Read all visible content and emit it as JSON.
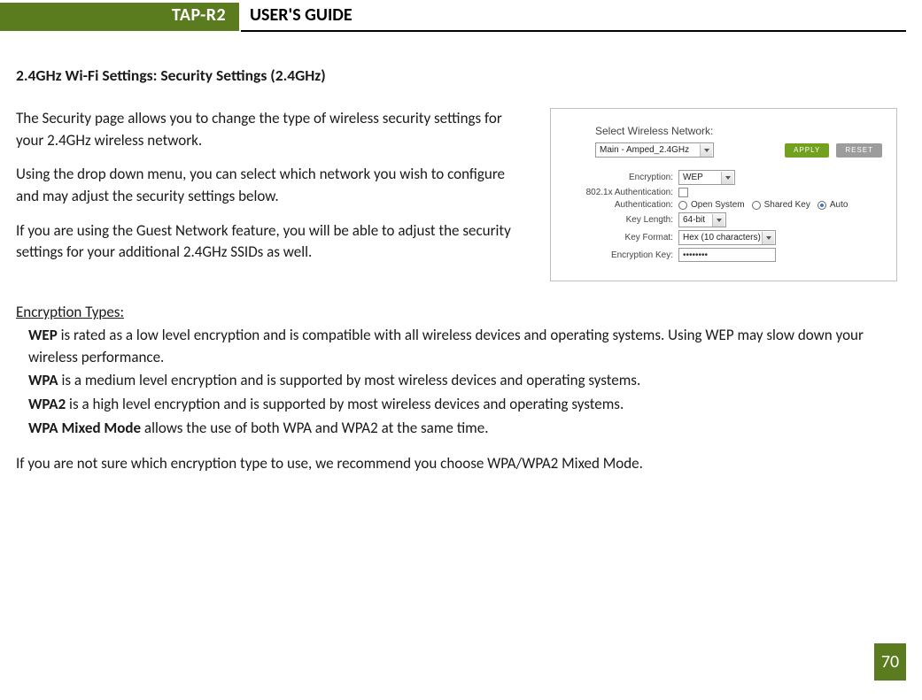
{
  "header": {
    "model": "TAP-R2",
    "title": "USER'S GUIDE"
  },
  "section_title": "2.4GHz Wi-Fi Settings: Security Settings (2.4GHz)",
  "paras": {
    "p1": "The Security page allows you to change the type of wireless security settings for your 2.4GHz wireless network.",
    "p2": "Using the drop down menu, you can select which network you wish to configure and may adjust the security settings below.",
    "p3": "If you are using the Guest Network feature, you will be able to adjust the security settings for your additional 2.4GHz SSIDs as well."
  },
  "figure": {
    "heading": "Select Wireless Network:",
    "network_selected": "Main - Amped_2.4GHz",
    "apply": "APPLY",
    "reset": "RESET",
    "rows": {
      "encryption_label": "Encryption:",
      "encryption_value": "WEP",
      "auth8021x_label": "802.1x Authentication:",
      "auth_label": "Authentication:",
      "auth_open": "Open System",
      "auth_shared": "Shared Key",
      "auth_auto": "Auto",
      "keylen_label": "Key Length:",
      "keylen_value": "64-bit",
      "keyfmt_label": "Key Format:",
      "keyfmt_value": "Hex (10 characters)",
      "enckey_label": "Encryption Key:",
      "enckey_value": "••••••••"
    }
  },
  "encryption": {
    "heading": "Encryption Types:",
    "items": [
      {
        "name": "WEP",
        "desc": " is rated as a low level encryption and is compatible with all wireless devices and operating systems. Using WEP may slow down your wireless performance."
      },
      {
        "name": "WPA",
        "desc": " is a medium level encryption and is supported by most wireless devices and operating systems."
      },
      {
        "name": "WPA2",
        "desc": " is a high level encryption and is supported by most wireless devices and operating systems."
      },
      {
        "name": "WPA Mixed Mode",
        "desc": " allows the use of both WPA and WPA2 at the same time."
      }
    ]
  },
  "footer_para": "If you are not sure which encryption type to use, we recommend you choose WPA/WPA2 Mixed Mode.",
  "page_number": "70"
}
